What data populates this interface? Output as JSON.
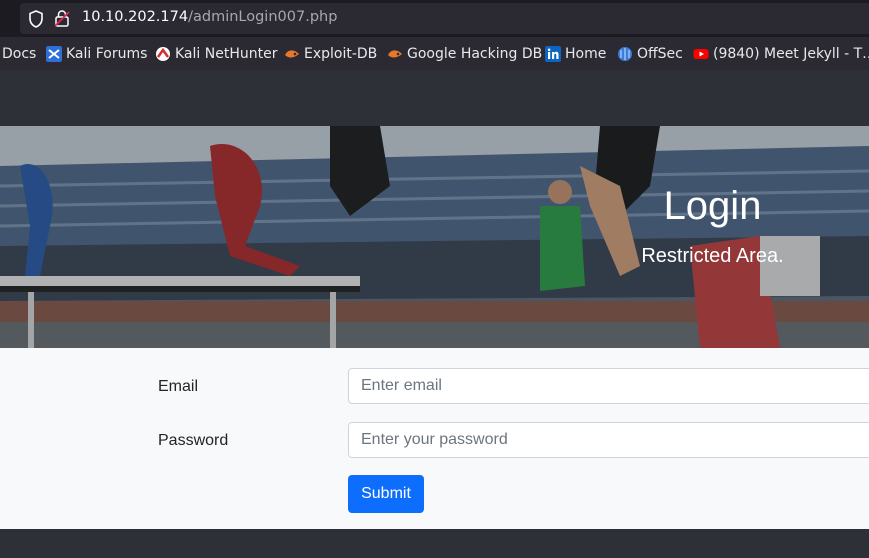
{
  "browser": {
    "url_host": "10.10.202.174",
    "url_path": "/adminLogin007.php"
  },
  "bookmarks": [
    {
      "label": "Docs",
      "icon": "docs-icon"
    },
    {
      "label": "Kali Forums",
      "icon": "kali-forums-icon"
    },
    {
      "label": "Kali NetHunter",
      "icon": "kali-nethunter-icon"
    },
    {
      "label": "Exploit-DB",
      "icon": "exploit-db-icon"
    },
    {
      "label": "Google Hacking DB",
      "icon": "ghdb-icon"
    },
    {
      "label": "Home",
      "icon": "linkedin-icon"
    },
    {
      "label": "OffSec",
      "icon": "offsec-icon"
    },
    {
      "label": "(9840) Meet Jekyll - T…",
      "icon": "youtube-icon"
    }
  ],
  "hero": {
    "title": "Login",
    "subtitle": "Restricted Area."
  },
  "form": {
    "email_label": "Email",
    "email_placeholder": "Enter email",
    "password_label": "Password",
    "password_placeholder": "Enter your password",
    "submit_label": "Submit"
  },
  "colors": {
    "primary_button": "#0d6efd",
    "form_background": "#f8f9fa",
    "browser_chrome": "#2b2a33"
  }
}
